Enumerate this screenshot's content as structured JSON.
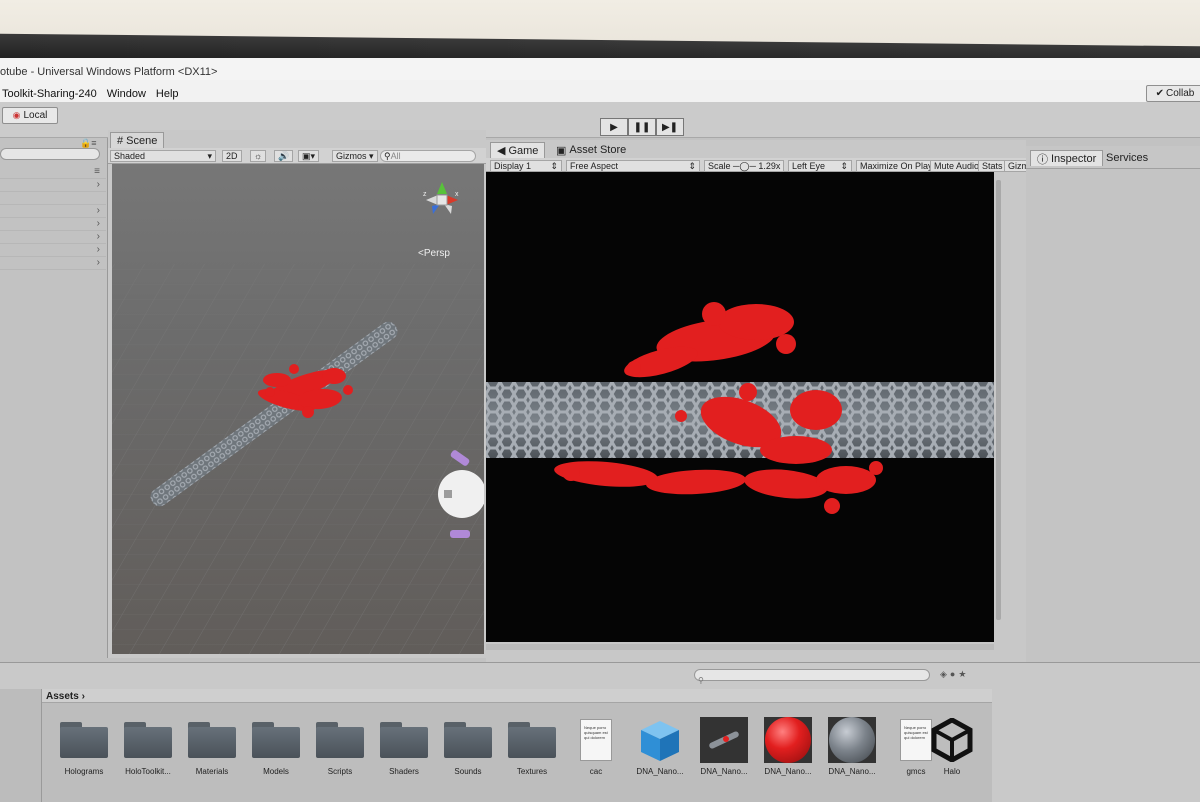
{
  "window": {
    "title": "otube - Universal Windows Platform <DX11>"
  },
  "menu": {
    "items": [
      "Toolkit-Sharing-240",
      "Window",
      "Help"
    ]
  },
  "toolbar": {
    "local_label": "Local",
    "collab_label": "Collab"
  },
  "scene": {
    "tab_label": "Scene",
    "shading_mode": "Shaded",
    "mode_2d": "2D",
    "gizmos_label": "Gizmos",
    "search_placeholder": "All",
    "persp_label": "<Persp"
  },
  "game": {
    "tab_label": "Game",
    "asset_store_tab": "Asset Store",
    "display": "Display 1",
    "aspect": "Free Aspect",
    "scale_label": "Scale",
    "scale_value": "1.29x",
    "eye": "Left Eye",
    "maximize_on_play": "Maximize On Play",
    "mute_audio": "Mute Audio",
    "stats": "Stats",
    "gizmos_truncated": "Gizm"
  },
  "inspector": {
    "tab_label": "Inspector",
    "services_tab": "Services"
  },
  "project": {
    "breadcrumb": "Assets",
    "assets": [
      {
        "label": "Holograms",
        "kind": "folder"
      },
      {
        "label": "HoloToolkit...",
        "kind": "folder"
      },
      {
        "label": "Materials",
        "kind": "folder"
      },
      {
        "label": "Models",
        "kind": "folder"
      },
      {
        "label": "Scripts",
        "kind": "folder"
      },
      {
        "label": "Shaders",
        "kind": "folder"
      },
      {
        "label": "Sounds",
        "kind": "folder"
      },
      {
        "label": "Textures",
        "kind": "folder"
      },
      {
        "label": "cac",
        "kind": "document"
      },
      {
        "label": "DNA_Nano...",
        "kind": "cube"
      },
      {
        "label": "DNA_Nano...",
        "kind": "model"
      },
      {
        "label": "DNA_Nano...",
        "kind": "red-material"
      },
      {
        "label": "DNA_Nano...",
        "kind": "grey-material"
      },
      {
        "label": "gmcs",
        "kind": "document"
      },
      {
        "label": "Halo",
        "kind": "unity-logo"
      }
    ],
    "doc_text": "Neque porro quisquam est qui dolorem"
  },
  "colors": {
    "dna_red": "#e21f1f",
    "nanotube_grey": "#8c9299",
    "game_background": "#050505",
    "editor_grey": "#c2c2c2"
  }
}
